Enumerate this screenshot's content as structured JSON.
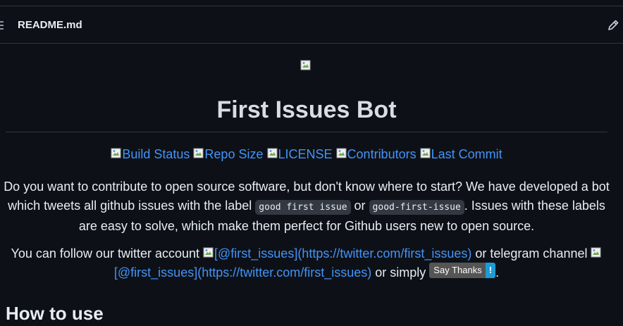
{
  "file": {
    "name": "README.md"
  },
  "readme": {
    "title": "First Issues Bot",
    "badges": [
      {
        "alt": "Build Status"
      },
      {
        "alt": "Repo Size"
      },
      {
        "alt": "LICENSE"
      },
      {
        "alt": "Contributors"
      },
      {
        "alt": "Last Commit"
      }
    ],
    "intro": {
      "before": "Do you want to contribute to open source software, but don't know where to start? We have developed a bot which tweets all github issues with the label ",
      "code1": "good first issue",
      "middle": " or ",
      "code2": "good-first-issue",
      "after": ". Issues with these labels are easy to solve, which make them perfect for Github users new to open source."
    },
    "follow": {
      "before": "You can follow our twitter account ",
      "twitter_link": "[@first_issues](https://twitter.com/first_issues)",
      "middle": " or telegram channel ",
      "telegram_link": "[@first_issues](https://twitter.com/first_issues)",
      "after": " or simply ",
      "say_thanks_label": "Say Thanks",
      "say_thanks_mark": "!",
      "end": "."
    },
    "section_heading": "How to use"
  },
  "colors": {
    "background": "#0d1117",
    "link": "#4493f8",
    "border": "#30363d",
    "code_bg": "#343941",
    "badge_left": "#555555",
    "badge_right": "#1c9bd6"
  },
  "icons": {
    "file_menu": "list-icon",
    "edit": "pencil-icon",
    "broken_image": "broken-image-icon"
  }
}
